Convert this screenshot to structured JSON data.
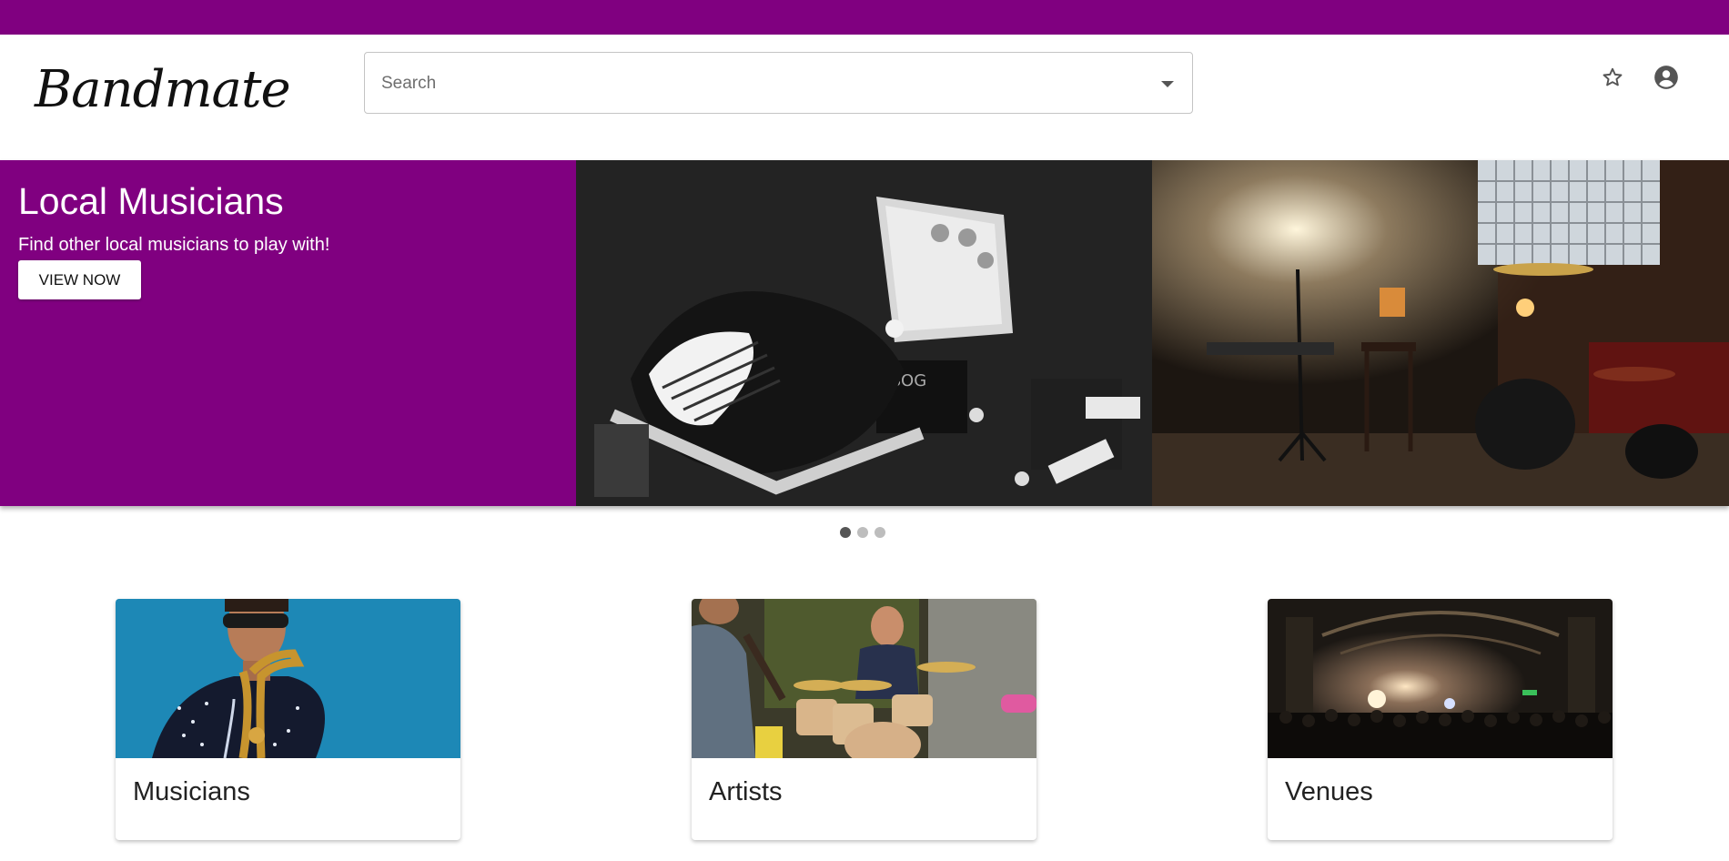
{
  "app": {
    "logo": "Bandmate"
  },
  "search": {
    "placeholder": "Search"
  },
  "header_icons": [
    "star-icon",
    "account-icon"
  ],
  "carousel": {
    "title": "Local Musicians",
    "subtitle": "Find other local musicians to play with!",
    "button_label": "VIEW NOW",
    "slide_count": 3,
    "active_slide": 1
  },
  "cards": [
    {
      "title": "Musicians"
    },
    {
      "title": "Artists"
    },
    {
      "title": "Venues"
    }
  ],
  "colors": {
    "brand": "#800080",
    "background": "#ffffff"
  }
}
